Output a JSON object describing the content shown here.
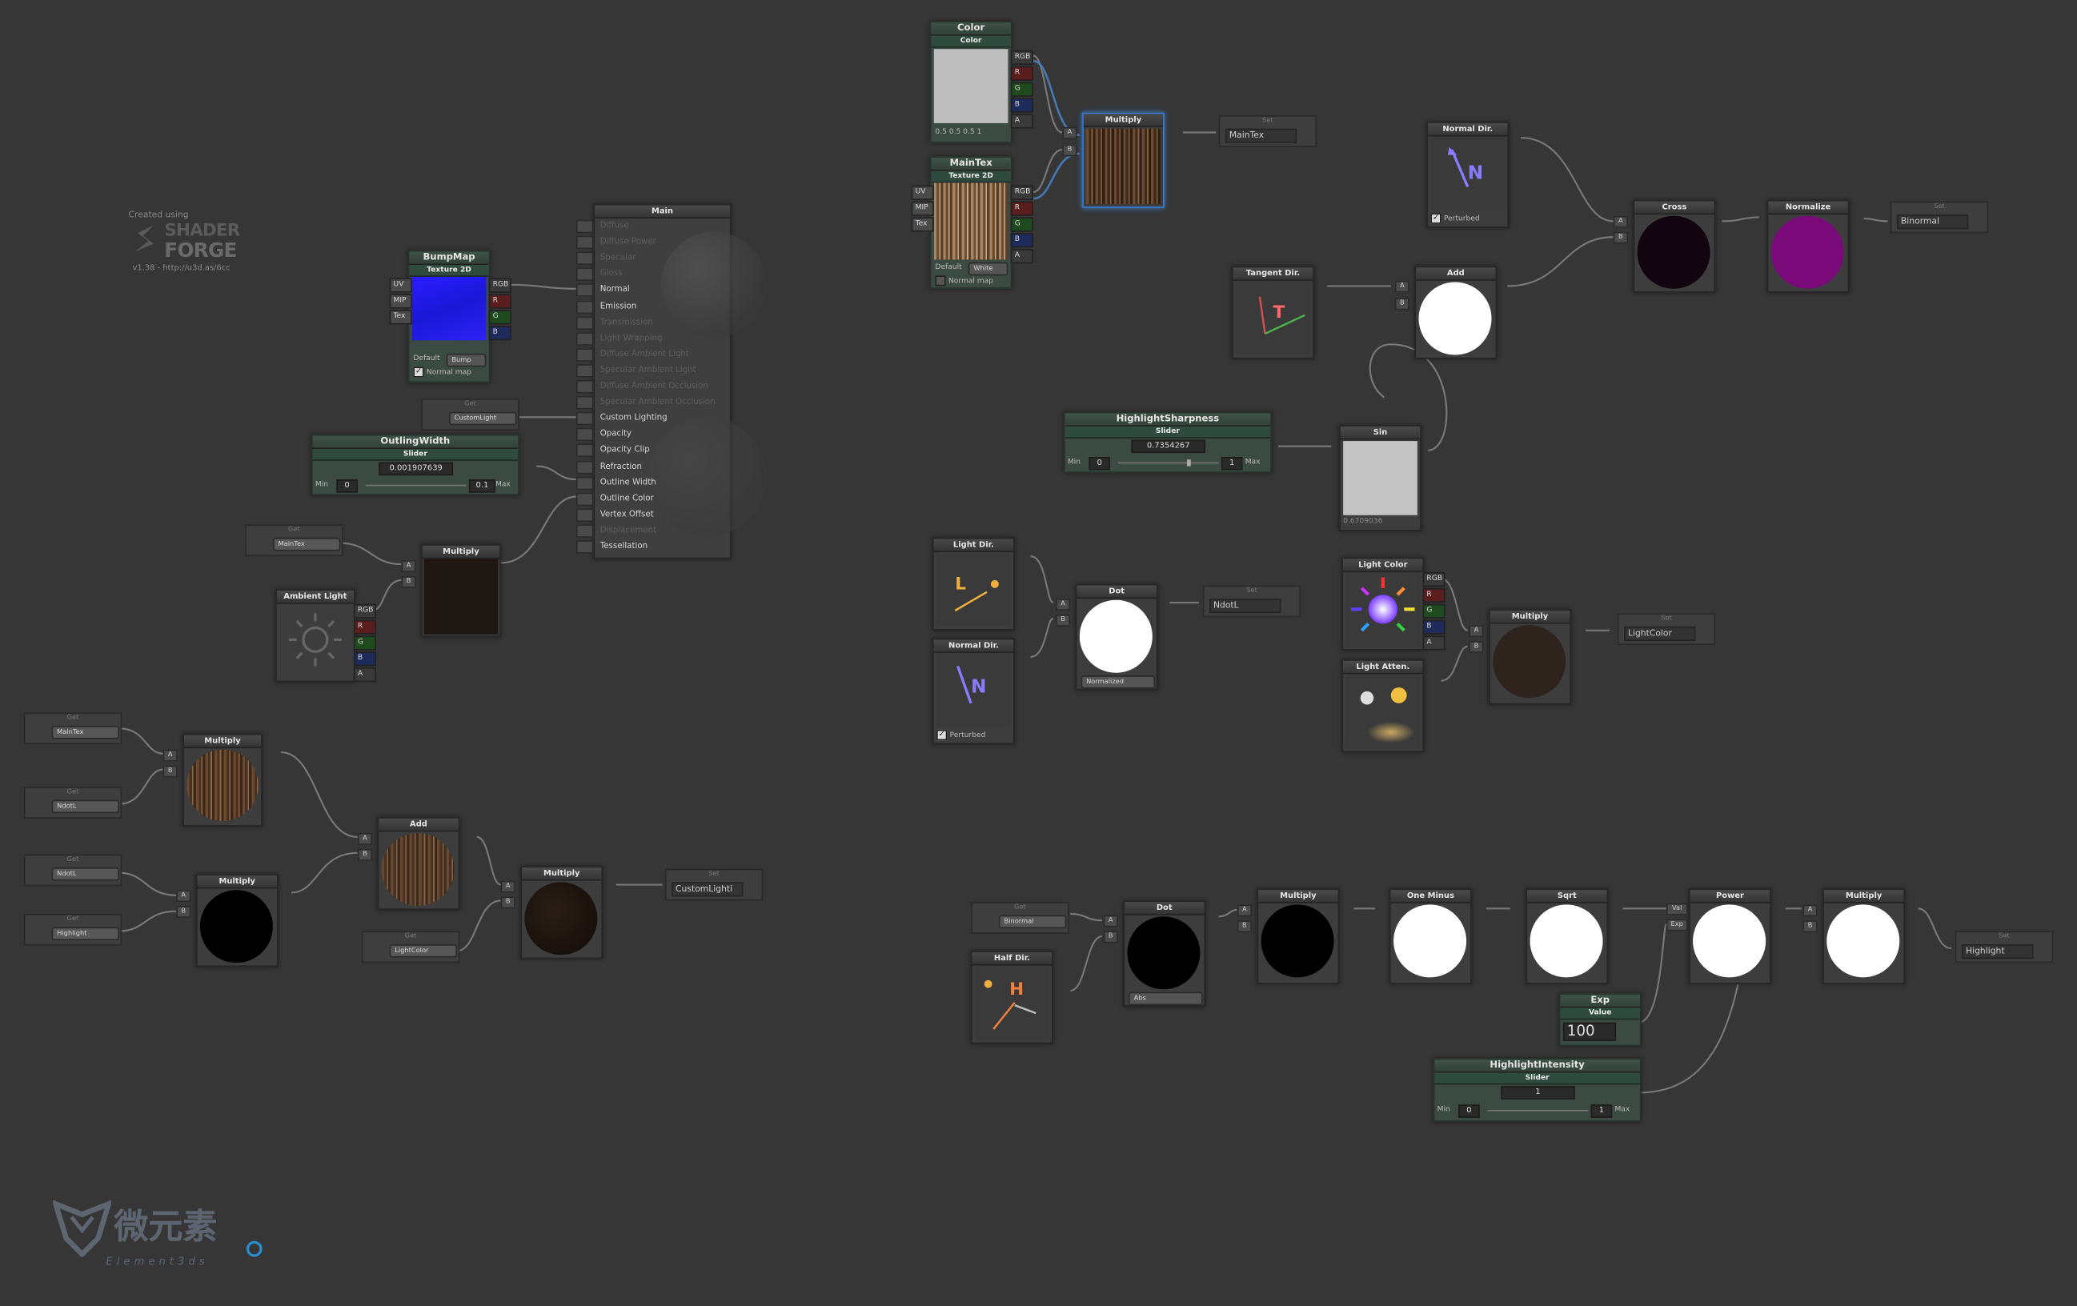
{
  "watermark": {
    "created_using": "Created using",
    "brand_line1": "SHADER",
    "brand_line2": "FORGE",
    "version": "v1.38 - http://u3d.as/6cc"
  },
  "logo": {
    "cn": "微元素",
    "en": "Element3ds"
  },
  "ports": {
    "rgb": "RGB",
    "r": "R",
    "g": "G",
    "b": "B",
    "a": "A",
    "uv": "UV",
    "mip": "MIP",
    "tex": "Tex",
    "val": "Val",
    "exp": "Exp"
  },
  "common": {
    "get": "Get",
    "set": "Set",
    "multiply": "Multiply",
    "add": "Add",
    "dot": "Dot",
    "min": "Min",
    "max": "Max",
    "slider": "Slider",
    "value": "Value",
    "texture2d": "Texture 2D",
    "perturbed": "Perturbed",
    "normal_map": "Normal map",
    "default": "Default",
    "normalized": "Normalized",
    "abs": "Abs",
    "color": "Color"
  },
  "main_node": {
    "title": "Main",
    "inputs": [
      {
        "label": "Diffuse",
        "active": false
      },
      {
        "label": "Diffuse Power",
        "active": false
      },
      {
        "label": "Specular",
        "active": false
      },
      {
        "label": "Gloss",
        "active": false
      },
      {
        "label": "Normal",
        "active": true
      },
      {
        "label": "Emission",
        "active": true
      },
      {
        "label": "Transmission",
        "active": false
      },
      {
        "label": "Light Wrapping",
        "active": false
      },
      {
        "label": "Diffuse Ambient Light",
        "active": false
      },
      {
        "label": "Specular Ambient Light",
        "active": false
      },
      {
        "label": "Diffuse Ambient Occlusion",
        "active": false
      },
      {
        "label": "Specular Ambient Occlusion",
        "active": false
      },
      {
        "label": "Custom Lighting",
        "active": true
      },
      {
        "label": "Opacity",
        "active": true
      },
      {
        "label": "Opacity Clip",
        "active": true
      },
      {
        "label": "Refraction",
        "active": true
      },
      {
        "label": "Outline Width",
        "active": true
      },
      {
        "label": "Outline Color",
        "active": true
      },
      {
        "label": "Vertex Offset",
        "active": true
      },
      {
        "label": "Displacement",
        "active": false
      },
      {
        "label": "Tessellation",
        "active": true
      }
    ]
  },
  "bumpmap": {
    "title": "BumpMap",
    "default_value": "Default",
    "mode": "Bump"
  },
  "get_customlight": "CustomLight",
  "outline_width": {
    "title": "OutlingWidth",
    "value": "0.001907639",
    "min": "0",
    "max": "0.1"
  },
  "get_maintex_a": "MainTex",
  "ambient_light": {
    "title": "Ambient Light"
  },
  "get_maintex_b": "MainTex",
  "get_ndotl_a": "NdotL",
  "get_ndotl_b": "NdotL",
  "get_highlight": "Highlight",
  "get_lightcolor": "LightColor",
  "set_customlighting": "CustomLighti",
  "color_node": {
    "title": "Color",
    "values": [
      "0.5",
      "0.5",
      "0.5",
      "1"
    ]
  },
  "maintex_node": {
    "title": "MainTex",
    "default_value": "Default",
    "mode": "White"
  },
  "set_maintex": "MainTex",
  "normal_dir_a": {
    "title": "Normal Dir."
  },
  "cross_node": {
    "title": "Cross"
  },
  "normalize_node": {
    "title": "Normalize"
  },
  "set_binormal": "Binormal",
  "tangent_dir": {
    "title": "Tangent Dir."
  },
  "highlight_sharpness": {
    "title": "HighlightSharpness",
    "value": "0.7354267",
    "min": "0",
    "max": "1"
  },
  "sin_node": {
    "title": "Sin",
    "value": "0.6709036"
  },
  "light_dir": {
    "title": "Light Dir."
  },
  "normal_dir_b": {
    "title": "Normal Dir."
  },
  "set_ndotl": "NdotL",
  "light_color": {
    "title": "Light Color"
  },
  "light_atten": {
    "title": "Light Atten."
  },
  "set_lightcolor": "LightColor",
  "get_binormal": "Binormal",
  "half_dir": {
    "title": "Half Dir."
  },
  "one_minus": {
    "title": "One Minus"
  },
  "sqrt_node": {
    "title": "Sqrt"
  },
  "power_node": {
    "title": "Power"
  },
  "exp_node": {
    "title": "Exp",
    "value": "100"
  },
  "highlight_intensity": {
    "title": "HighlightIntensity",
    "value": "1",
    "min": "0",
    "max": "1"
  },
  "set_highlight": "Highlight",
  "colors": {
    "background": "#363636",
    "wire": "#8a8a8a",
    "property_green": "#3b4a42",
    "selection_blue": "#3b7fd0",
    "binormal_purple": "#7a0a7a"
  }
}
